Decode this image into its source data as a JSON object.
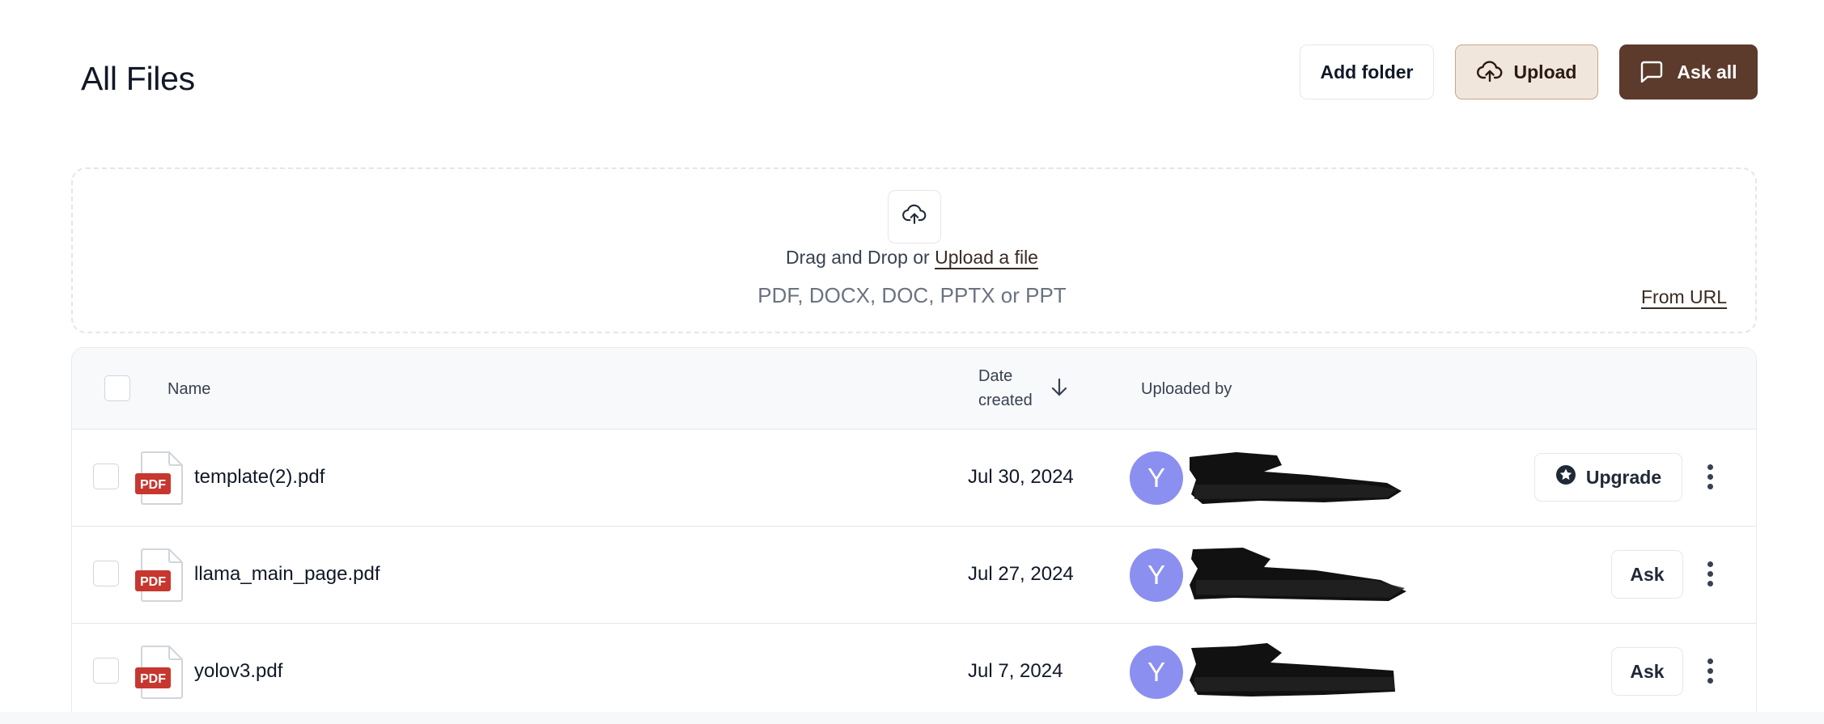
{
  "header": {
    "title": "All Files",
    "add_folder_label": "Add folder",
    "upload_label": "Upload",
    "ask_all_label": "Ask all"
  },
  "dropzone": {
    "prefix": "Drag and Drop or ",
    "link": "Upload a file",
    "types": "PDF, DOCX, DOC, PPTX or PPT",
    "from_url": "From URL"
  },
  "table": {
    "columns": {
      "name": "Name",
      "date_line1": "Date",
      "date_line2": "created",
      "uploaded_by": "Uploaded by"
    },
    "rows": [
      {
        "name": "template(2).pdf",
        "date": "Jul 30, 2024",
        "avatar": "Y",
        "action": "Upgrade",
        "file_badge": "PDF"
      },
      {
        "name": "llama_main_page.pdf",
        "date": "Jul 27, 2024",
        "avatar": "Y",
        "action": "Ask",
        "file_badge": "PDF"
      },
      {
        "name": "yolov3.pdf",
        "date": "Jul 7, 2024",
        "avatar": "Y",
        "action": "Ask",
        "file_badge": "PDF"
      }
    ]
  },
  "colors": {
    "accent_dark": "#5c3a2c",
    "upload_bg": "#f1e6dc",
    "avatar": "#8b8ff0",
    "pdf_badge": "#c7372f"
  },
  "icons": [
    "cloud-upload-icon",
    "chat-bubble-icon",
    "arrow-down-icon",
    "pdf-file-icon",
    "star-badge-icon",
    "more-vertical-icon"
  ]
}
